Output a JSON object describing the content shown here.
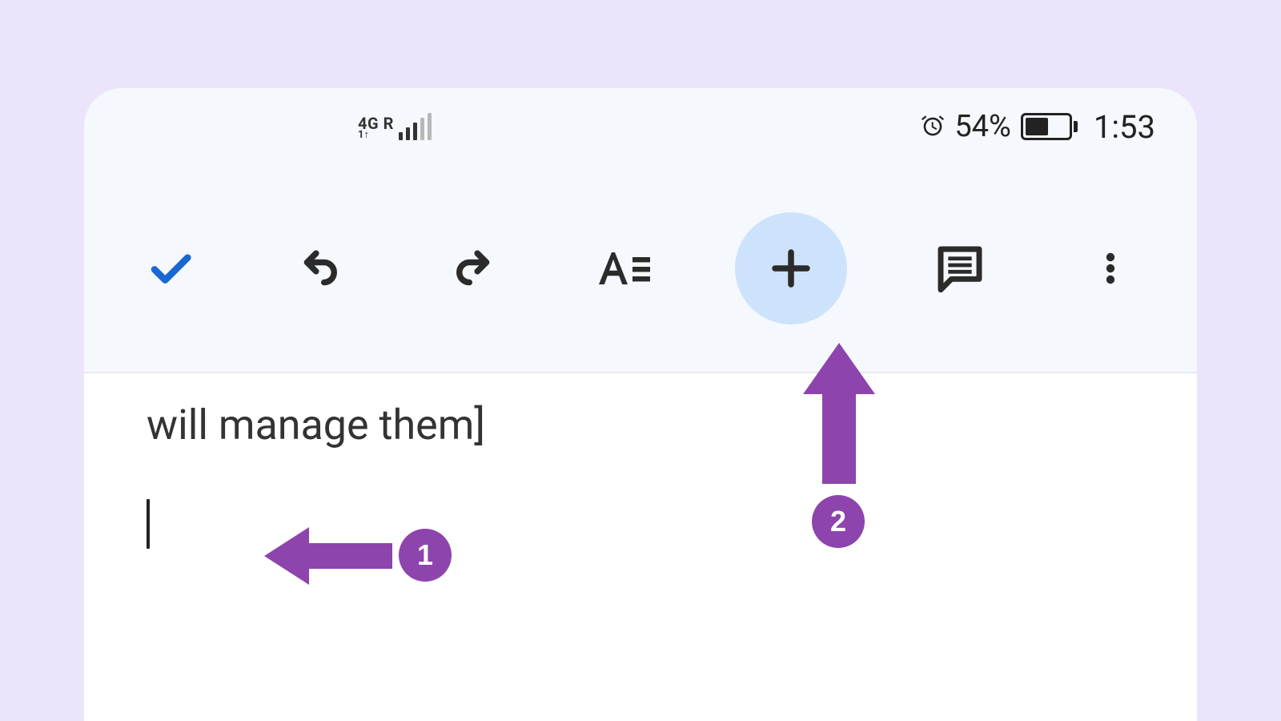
{
  "status": {
    "network_label": "4G R",
    "network_sub": "1↑",
    "battery_percent_text": "54%",
    "battery_fill_pct": 54,
    "time": "1:53"
  },
  "toolbar": {
    "done_label": "Done",
    "undo_label": "Undo",
    "redo_label": "Redo",
    "format_label": "Text formatting",
    "insert_label": "Insert",
    "comment_label": "Add comment",
    "more_label": "More options",
    "highlighted": "insert"
  },
  "document": {
    "visible_text": "will manage them]"
  },
  "annotations": {
    "step1": "1",
    "step2": "2"
  },
  "colors": {
    "page_bg": "#ECE4FB",
    "toolbar_bg": "#F5F8FC",
    "highlight_bg": "#CDE3FB",
    "accent_check": "#1967D2",
    "annotation": "#8E44AD"
  }
}
